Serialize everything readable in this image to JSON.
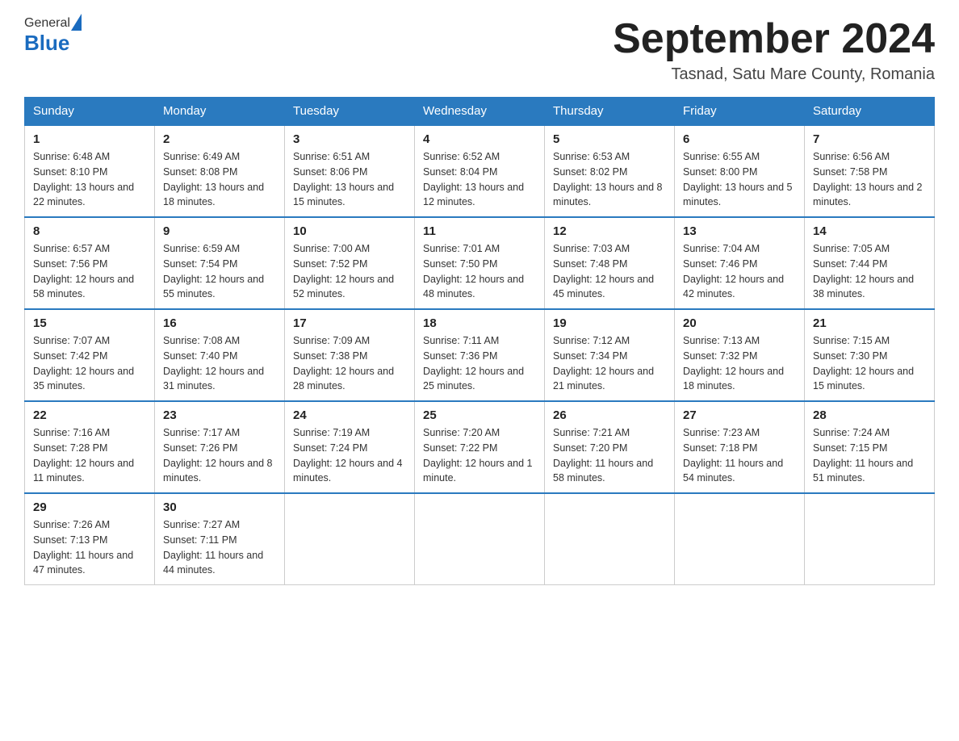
{
  "header": {
    "logo_general": "General",
    "logo_blue": "Blue",
    "month_title": "September 2024",
    "subtitle": "Tasnad, Satu Mare County, Romania"
  },
  "weekdays": [
    "Sunday",
    "Monday",
    "Tuesday",
    "Wednesday",
    "Thursday",
    "Friday",
    "Saturday"
  ],
  "weeks": [
    [
      {
        "day": "1",
        "sunrise": "6:48 AM",
        "sunset": "8:10 PM",
        "daylight": "13 hours and 22 minutes."
      },
      {
        "day": "2",
        "sunrise": "6:49 AM",
        "sunset": "8:08 PM",
        "daylight": "13 hours and 18 minutes."
      },
      {
        "day": "3",
        "sunrise": "6:51 AM",
        "sunset": "8:06 PM",
        "daylight": "13 hours and 15 minutes."
      },
      {
        "day": "4",
        "sunrise": "6:52 AM",
        "sunset": "8:04 PM",
        "daylight": "13 hours and 12 minutes."
      },
      {
        "day": "5",
        "sunrise": "6:53 AM",
        "sunset": "8:02 PM",
        "daylight": "13 hours and 8 minutes."
      },
      {
        "day": "6",
        "sunrise": "6:55 AM",
        "sunset": "8:00 PM",
        "daylight": "13 hours and 5 minutes."
      },
      {
        "day": "7",
        "sunrise": "6:56 AM",
        "sunset": "7:58 PM",
        "daylight": "13 hours and 2 minutes."
      }
    ],
    [
      {
        "day": "8",
        "sunrise": "6:57 AM",
        "sunset": "7:56 PM",
        "daylight": "12 hours and 58 minutes."
      },
      {
        "day": "9",
        "sunrise": "6:59 AM",
        "sunset": "7:54 PM",
        "daylight": "12 hours and 55 minutes."
      },
      {
        "day": "10",
        "sunrise": "7:00 AM",
        "sunset": "7:52 PM",
        "daylight": "12 hours and 52 minutes."
      },
      {
        "day": "11",
        "sunrise": "7:01 AM",
        "sunset": "7:50 PM",
        "daylight": "12 hours and 48 minutes."
      },
      {
        "day": "12",
        "sunrise": "7:03 AM",
        "sunset": "7:48 PM",
        "daylight": "12 hours and 45 minutes."
      },
      {
        "day": "13",
        "sunrise": "7:04 AM",
        "sunset": "7:46 PM",
        "daylight": "12 hours and 42 minutes."
      },
      {
        "day": "14",
        "sunrise": "7:05 AM",
        "sunset": "7:44 PM",
        "daylight": "12 hours and 38 minutes."
      }
    ],
    [
      {
        "day": "15",
        "sunrise": "7:07 AM",
        "sunset": "7:42 PM",
        "daylight": "12 hours and 35 minutes."
      },
      {
        "day": "16",
        "sunrise": "7:08 AM",
        "sunset": "7:40 PM",
        "daylight": "12 hours and 31 minutes."
      },
      {
        "day": "17",
        "sunrise": "7:09 AM",
        "sunset": "7:38 PM",
        "daylight": "12 hours and 28 minutes."
      },
      {
        "day": "18",
        "sunrise": "7:11 AM",
        "sunset": "7:36 PM",
        "daylight": "12 hours and 25 minutes."
      },
      {
        "day": "19",
        "sunrise": "7:12 AM",
        "sunset": "7:34 PM",
        "daylight": "12 hours and 21 minutes."
      },
      {
        "day": "20",
        "sunrise": "7:13 AM",
        "sunset": "7:32 PM",
        "daylight": "12 hours and 18 minutes."
      },
      {
        "day": "21",
        "sunrise": "7:15 AM",
        "sunset": "7:30 PM",
        "daylight": "12 hours and 15 minutes."
      }
    ],
    [
      {
        "day": "22",
        "sunrise": "7:16 AM",
        "sunset": "7:28 PM",
        "daylight": "12 hours and 11 minutes."
      },
      {
        "day": "23",
        "sunrise": "7:17 AM",
        "sunset": "7:26 PM",
        "daylight": "12 hours and 8 minutes."
      },
      {
        "day": "24",
        "sunrise": "7:19 AM",
        "sunset": "7:24 PM",
        "daylight": "12 hours and 4 minutes."
      },
      {
        "day": "25",
        "sunrise": "7:20 AM",
        "sunset": "7:22 PM",
        "daylight": "12 hours and 1 minute."
      },
      {
        "day": "26",
        "sunrise": "7:21 AM",
        "sunset": "7:20 PM",
        "daylight": "11 hours and 58 minutes."
      },
      {
        "day": "27",
        "sunrise": "7:23 AM",
        "sunset": "7:18 PM",
        "daylight": "11 hours and 54 minutes."
      },
      {
        "day": "28",
        "sunrise": "7:24 AM",
        "sunset": "7:15 PM",
        "daylight": "11 hours and 51 minutes."
      }
    ],
    [
      {
        "day": "29",
        "sunrise": "7:26 AM",
        "sunset": "7:13 PM",
        "daylight": "11 hours and 47 minutes."
      },
      {
        "day": "30",
        "sunrise": "7:27 AM",
        "sunset": "7:11 PM",
        "daylight": "11 hours and 44 minutes."
      },
      null,
      null,
      null,
      null,
      null
    ]
  ],
  "labels": {
    "sunrise": "Sunrise:",
    "sunset": "Sunset:",
    "daylight": "Daylight:"
  }
}
